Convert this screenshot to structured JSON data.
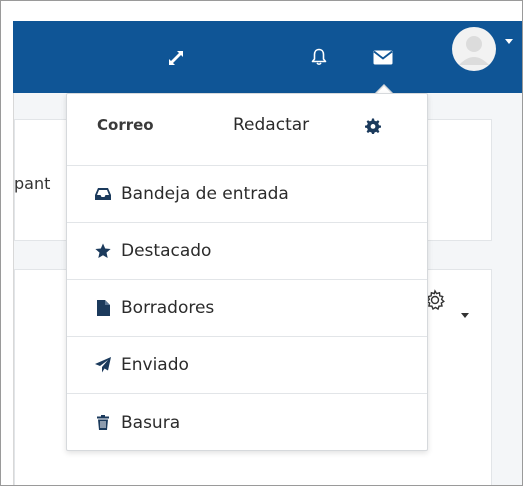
{
  "colors": {
    "navbar": "#0f5596",
    "icon_dark": "#1b3a5c",
    "text": "#2b2b2b"
  },
  "background": {
    "partial_text": "pant"
  },
  "navbar": {
    "icons": [
      "expand-icon",
      "bell-icon",
      "envelope-icon",
      "avatar",
      "caret-down-icon"
    ]
  },
  "dropdown": {
    "title": "Correo",
    "compose_label": "Redactar",
    "items": [
      {
        "label": "Bandeja de entrada",
        "icon": "inbox-icon"
      },
      {
        "label": "Destacado",
        "icon": "star-icon"
      },
      {
        "label": "Borradores",
        "icon": "file-icon"
      },
      {
        "label": "Enviado",
        "icon": "paper-plane-icon"
      },
      {
        "label": "Basura",
        "icon": "trash-icon"
      }
    ]
  }
}
